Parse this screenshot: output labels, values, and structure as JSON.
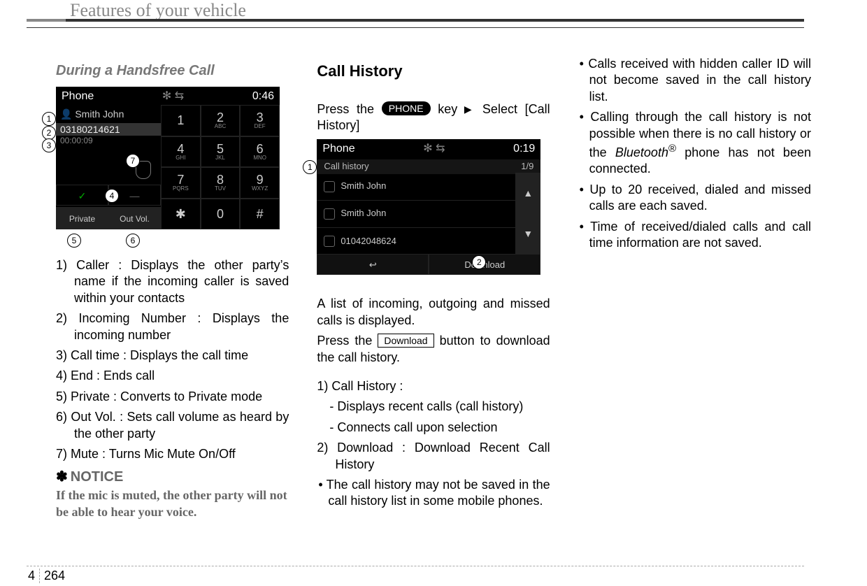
{
  "header": {
    "title": "Features of your vehicle"
  },
  "footer": {
    "section": "4",
    "page": "264"
  },
  "col1": {
    "heading": "During a Handsfree Call",
    "screenshot": {
      "title": "Phone",
      "clock": "0:46",
      "caller": "Smith John",
      "number": "03180214621",
      "time": "00:00:09",
      "btn_private": "Private",
      "btn_outvol": "Out Vol.",
      "keys": {
        "k1": "1",
        "k2": "2",
        "k2s": "ABC",
        "k3": "3",
        "k3s": "DEF",
        "k4": "4",
        "k4s": "GHI",
        "k5": "5",
        "k5s": "JKL",
        "k6": "6",
        "k6s": "MNO",
        "k7": "7",
        "k7s": "PQRS",
        "k8": "8",
        "k8s": "TUV",
        "k9": "9",
        "k9s": "WXYZ",
        "ks": "✱",
        "k0": "0",
        "kp": "#"
      },
      "callouts": {
        "c1": "1",
        "c2": "2",
        "c3": "3",
        "c4": "4",
        "c5": "5",
        "c6": "6",
        "c7": "7"
      }
    },
    "list": {
      "i1": "1) Caller : Displays the other party’s name if the incoming caller is saved within your contacts",
      "i2": "2) Incoming Number : Displays the incoming number",
      "i3": "3) Call time : Displays the call time",
      "i4": "4) End : Ends call",
      "i5": "5) Private : Converts to Private mode",
      "i6": "6) Out Vol. : Sets call volume as heard by the other party",
      "i7": "7) Mute : Turns Mic Mute On/Off"
    },
    "notice_label": "NOTICE",
    "notice_body": "If the mic is muted, the other party will not be able to hear your voice."
  },
  "col2": {
    "heading": "Call History",
    "p1a": "Press the ",
    "p1_phone": "PHONE",
    "p1b": " key",
    "p1_tri": " ▶ ",
    "p1c": "Select [Call History]",
    "screenshot": {
      "title": "Phone",
      "clock": "0:19",
      "sub_label": "Call history",
      "sub_page": "1/9",
      "li1": "Smith John",
      "li2": "Smith John",
      "li3": "01042048624",
      "up": "▲",
      "down": "▼",
      "back": "↩",
      "download": "Download",
      "callouts": {
        "c1": "1",
        "c2": "2"
      }
    },
    "p2": "A list of incoming, outgoing and missed calls is displayed.",
    "p3a": "Press the ",
    "p3_btn": "Download",
    "p3b": " button to download the call history.",
    "list": {
      "i1": "1) Call History :",
      "i1a": "- Displays recent calls (call history)",
      "i1b": "- Connects call upon selection",
      "i2": "2) Download : Download Recent Call History"
    },
    "bullet1": "The call history may not be saved in the call history list in some mobile phones."
  },
  "col3": {
    "b1": "Calls received with hidden caller ID will not become saved in the call history list.",
    "b2a": "Calling through the call history is not possible when there is no call history or the ",
    "b2_bt": "Bluetooth",
    "b2_reg": "®",
    "b2b": " phone has not been connected.",
    "b3": "Up to 20 received, dialed and missed calls are each saved.",
    "b4": "Time of received/dialed calls and call time information are not saved."
  }
}
